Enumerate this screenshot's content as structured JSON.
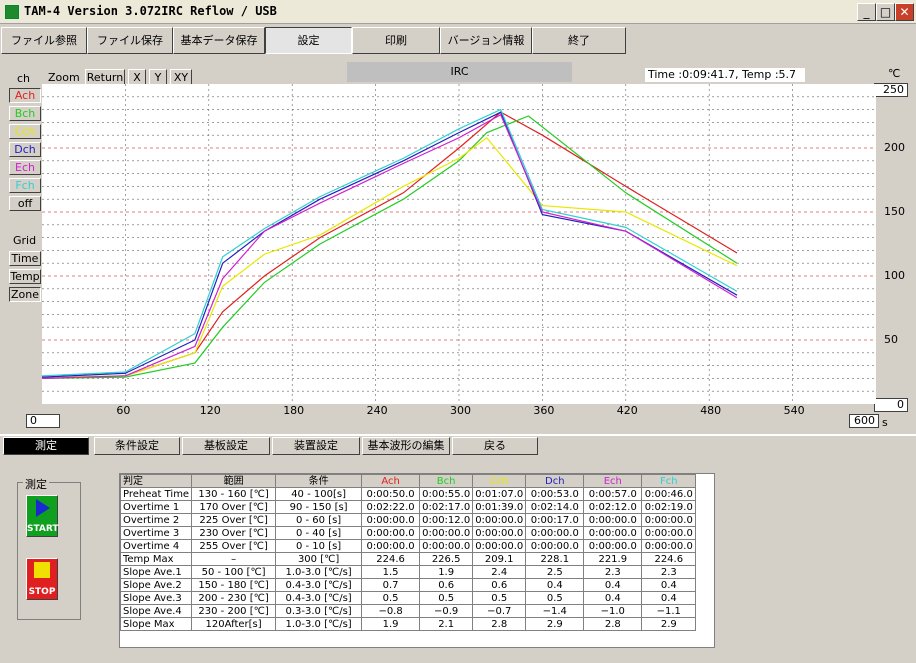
{
  "window": {
    "title": "TAM-4 Version 3.072IRC  Reflow / USB"
  },
  "toolbar": [
    "ファイル参照",
    "ファイル保存",
    "基本データ保存",
    "設定",
    "印刷",
    "バージョン情報",
    "終了"
  ],
  "chart_panel": {
    "ch_label": "ch",
    "zoom_label": "Zoom",
    "return_label": "Return",
    "x_label": "X",
    "y_label": "Y",
    "xy_label": "XY",
    "center_title": "IRC",
    "status": "Time :0:09:41.7,  Temp :5.7",
    "unit": "℃",
    "ymax_value": "250",
    "ymin_value": "0",
    "xmin_value": "0",
    "xmax_value": "600",
    "xunit": "s",
    "channels": [
      {
        "label": "Ach",
        "color": "#e02020"
      },
      {
        "label": "Bch",
        "color": "#22cc22"
      },
      {
        "label": "Cch",
        "color": "#e8e800"
      },
      {
        "label": "Dch",
        "color": "#2020c0"
      },
      {
        "label": "Ech",
        "color": "#d020d0"
      },
      {
        "label": "Fch",
        "color": "#30d0d0"
      }
    ],
    "off_label": "off",
    "grid_label": "Grid",
    "grid_buttons": [
      "Time",
      "Temp",
      "Zone"
    ]
  },
  "chart_data": {
    "type": "line",
    "x_ticks": [
      60,
      120,
      180,
      240,
      300,
      360,
      420,
      480,
      540
    ],
    "y_ticks": [
      50,
      100,
      150,
      200
    ],
    "xlim": [
      0,
      600
    ],
    "ylim": [
      0,
      250
    ],
    "series": [
      {
        "name": "Ach",
        "color": "#e02020",
        "x": [
          0,
          60,
          110,
          130,
          160,
          200,
          260,
          300,
          330,
          360,
          420,
          500
        ],
        "y": [
          20,
          22,
          40,
          72,
          100,
          130,
          165,
          200,
          228,
          210,
          170,
          118
        ]
      },
      {
        "name": "Bch",
        "color": "#22cc22",
        "x": [
          0,
          60,
          110,
          130,
          160,
          200,
          260,
          300,
          320,
          350,
          420,
          500
        ],
        "y": [
          20,
          21,
          32,
          60,
          95,
          125,
          160,
          190,
          212,
          225,
          165,
          110
        ]
      },
      {
        "name": "Cch",
        "color": "#e8e800",
        "x": [
          0,
          60,
          110,
          130,
          160,
          200,
          260,
          300,
          320,
          360,
          420,
          500
        ],
        "y": [
          21,
          22,
          40,
          92,
          117,
          132,
          170,
          192,
          208,
          155,
          150,
          108
        ]
      },
      {
        "name": "Dch",
        "color": "#2020c0",
        "x": [
          0,
          60,
          110,
          130,
          160,
          200,
          260,
          300,
          330,
          360,
          420,
          500
        ],
        "y": [
          21,
          24,
          50,
          110,
          135,
          160,
          190,
          212,
          228,
          148,
          135,
          85
        ]
      },
      {
        "name": "Ech",
        "color": "#d020d0",
        "x": [
          0,
          60,
          110,
          130,
          160,
          200,
          260,
          300,
          330,
          360,
          420,
          500
        ],
        "y": [
          20,
          22,
          45,
          98,
          135,
          157,
          188,
          208,
          226,
          150,
          135,
          83
        ]
      },
      {
        "name": "Fch",
        "color": "#30d0d0",
        "x": [
          0,
          60,
          110,
          130,
          160,
          200,
          260,
          300,
          330,
          360,
          420,
          500
        ],
        "y": [
          22,
          25,
          55,
          115,
          137,
          162,
          192,
          215,
          230,
          152,
          138,
          88
        ]
      }
    ]
  },
  "bottom_tabs": [
    "測定",
    "条件設定",
    "基板設定",
    "装置設定",
    "基本波形の編集",
    "戻る"
  ],
  "measure_group": {
    "title": "測定",
    "start_label": "START",
    "stop_label": "STOP"
  },
  "table": {
    "header": [
      "判定",
      "範囲",
      "条件",
      "Ach",
      "Bch",
      "Cch",
      "Dch",
      "Ech",
      "Fch"
    ],
    "header_colors": [
      "#000000",
      "#000000",
      "#000000",
      "#e02020",
      "#22cc22",
      "#e8e800",
      "#2020c0",
      "#d020d0",
      "#30d0d0"
    ],
    "rows": [
      [
        "Preheat Time",
        "130 - 160 [℃]",
        "40 - 100[s]",
        "0:00:50.0",
        "0:00:55.0",
        "0:01:07.0",
        "0:00:53.0",
        "0:00:57.0",
        "0:00:46.0"
      ],
      [
        "Overtime 1",
        "170 Over [℃]",
        "90 - 150 [s]",
        "0:02:22.0",
        "0:02:17.0",
        "0:01:39.0",
        "0:02:14.0",
        "0:02:12.0",
        "0:02:19.0"
      ],
      [
        "Overtime 2",
        "225 Over [℃]",
        "0 - 60 [s]",
        "0:00:00.0",
        "0:00:12.0",
        "0:00:00.0",
        "0:00:17.0",
        "0:00:00.0",
        "0:00:00.0"
      ],
      [
        "Overtime 3",
        "230 Over [℃]",
        "0 - 40 [s]",
        "0:00:00.0",
        "0:00:00.0",
        "0:00:00.0",
        "0:00:00.0",
        "0:00:00.0",
        "0:00:00.0"
      ],
      [
        "Overtime 4",
        "255 Over [℃]",
        "0 - 10 [s]",
        "0:00:00.0",
        "0:00:00.0",
        "0:00:00.0",
        "0:00:00.0",
        "0:00:00.0",
        "0:00:00.0"
      ],
      [
        "Temp Max",
        "–",
        "300 [℃]",
        "224.6",
        "226.5",
        "209.1",
        "228.1",
        "221.9",
        "224.6"
      ],
      [
        "Slope Ave.1",
        "50 - 100 [℃]",
        "1.0-3.0 [℃/s]",
        "1.5",
        "1.9",
        "2.4",
        "2.5",
        "2.3",
        "2.3"
      ],
      [
        "Slope Ave.2",
        "150 - 180 [℃]",
        "0.4-3.0 [℃/s]",
        "0.7",
        "0.6",
        "0.6",
        "0.4",
        "0.4",
        "0.4"
      ],
      [
        "Slope Ave.3",
        "200 - 230 [℃]",
        "0.4-3.0 [℃/s]",
        "0.5",
        "0.5",
        "0.5",
        "0.5",
        "0.4",
        "0.4"
      ],
      [
        "Slope Ave.4",
        "230 - 200 [℃]",
        "0.3-3.0 [℃/s]",
        "−0.8",
        "−0.9",
        "−0.7",
        "−1.4",
        "−1.0",
        "−1.1"
      ],
      [
        "Slope Max",
        "120After[s]",
        "1.0-3.0 [℃/s]",
        "1.9",
        "2.1",
        "2.8",
        "2.9",
        "2.8",
        "2.9"
      ]
    ]
  }
}
